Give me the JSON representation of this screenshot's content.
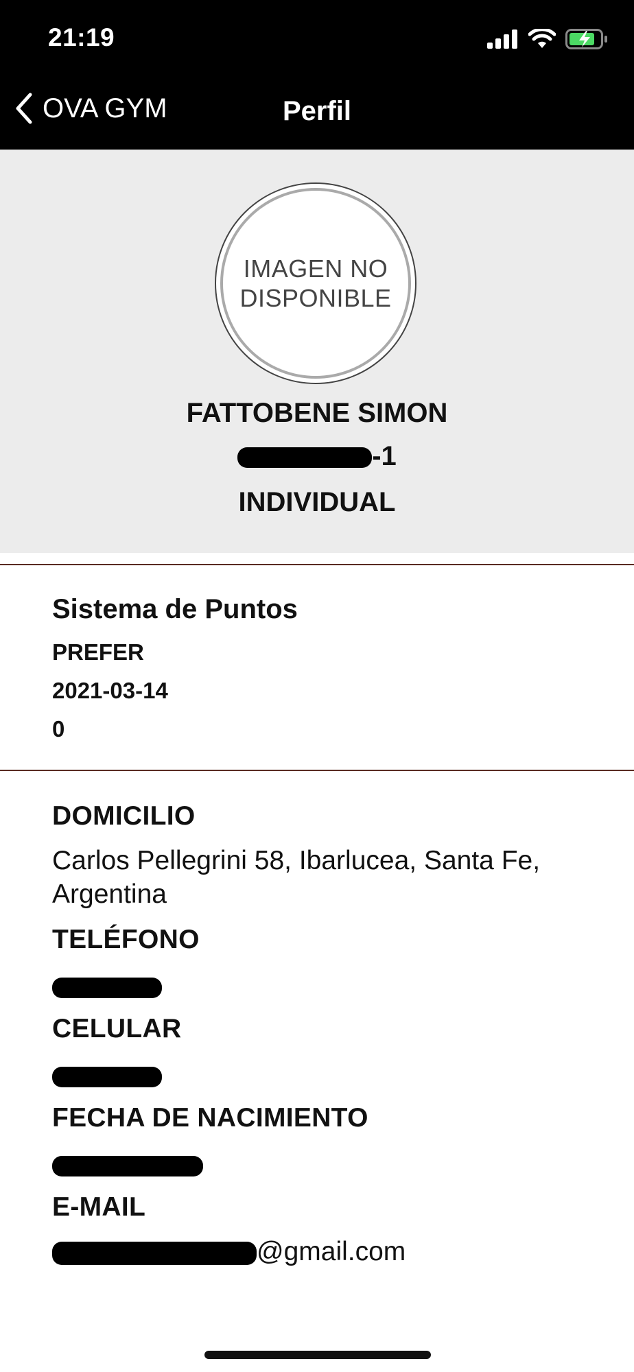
{
  "status_bar": {
    "time": "21:19"
  },
  "nav": {
    "back_label": "OVA GYM",
    "title": "Perfil"
  },
  "profile": {
    "avatar_text": "IMAGEN NO\nDISPONIBLE",
    "name": "FATTOBENE SIMON",
    "id_suffix": "-1",
    "plan": "INDIVIDUAL"
  },
  "points": {
    "title": "Sistema de Puntos",
    "level": "PREFER",
    "date": "2021-03-14",
    "points": "0"
  },
  "contact": {
    "address_label": "DOMICILIO",
    "address": "Carlos Pellegrini 58, Ibarlucea, Santa Fe, Argentina",
    "phone_label": "TELÉFONO",
    "mobile_label": "CELULAR",
    "birth_label": "FECHA DE NACIMIENTO",
    "email_label": "E-MAIL",
    "email_suffix": "@gmail.com"
  }
}
